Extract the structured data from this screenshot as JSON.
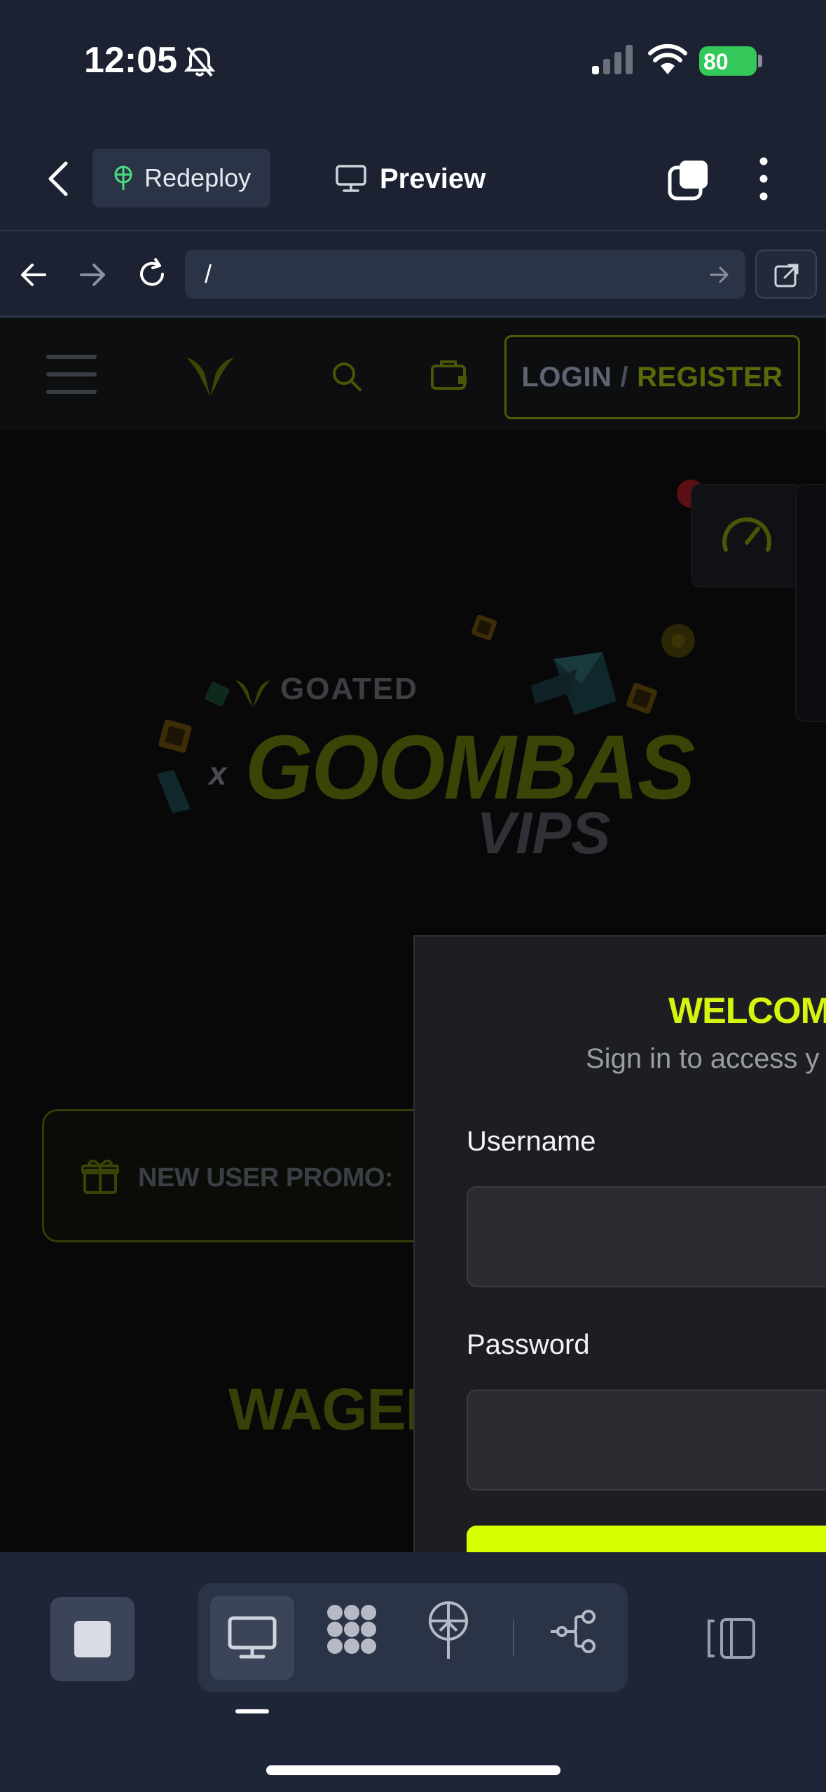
{
  "status_bar": {
    "time": "12:05",
    "battery": "80",
    "icons": [
      "bell-slash-icon",
      "cellular-signal-icon",
      "wifi-icon",
      "battery-charging-icon"
    ]
  },
  "app_header": {
    "back_icon": "chevron-left-icon",
    "redeploy_label": "Redeploy",
    "redeploy_icon": "deploy-tree-icon",
    "preview_label": "Preview",
    "preview_icon": "monitor-icon",
    "tabs_icon": "tabs-icon",
    "more_icon": "more-vertical-icon"
  },
  "url_bar": {
    "path": "/",
    "icons": [
      "arrow-left-icon",
      "arrow-right-icon",
      "reload-icon",
      "go-arrow-icon",
      "external-link-icon"
    ]
  },
  "site": {
    "header": {
      "login_label": "LOGIN",
      "separator": "/",
      "register_label": "REGISTER"
    },
    "hero": {
      "brand": "GOATED",
      "x": "x",
      "title": "GOOMBAS",
      "subtitle": "VIPS"
    },
    "promo_label": "NEW USER PROMO:",
    "wager_heading": "WAGER",
    "modal": {
      "title": "WELCOME",
      "subtitle": "Sign in to access y",
      "username_label": "Username",
      "password_label": "Password"
    }
  },
  "bottom_toolbar": {
    "icons": [
      "stop-icon",
      "desktop-icon",
      "modules-icon",
      "deploy-icon",
      "flow-icon",
      "split-panel-icon"
    ]
  },
  "colors": {
    "accent": "#d7ff00",
    "background": "#1c2231",
    "battery": "#34c759"
  }
}
